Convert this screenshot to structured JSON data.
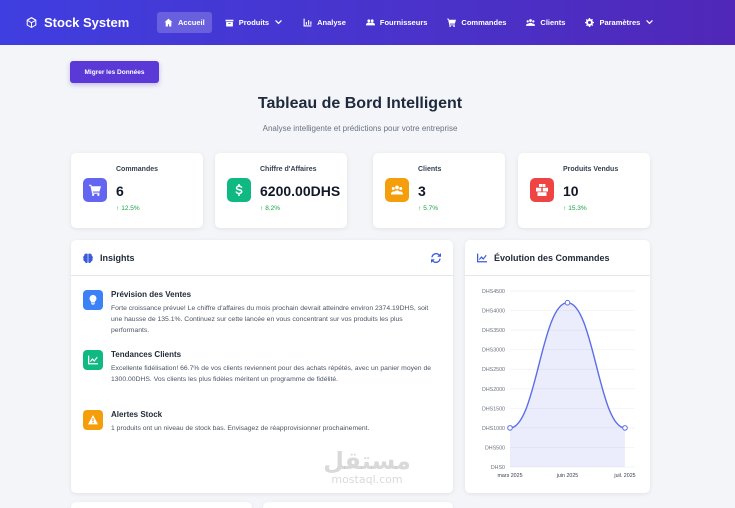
{
  "nav": {
    "brand": "Stock System",
    "items": [
      {
        "label": "Accueil",
        "icon": "home-icon",
        "active": true
      },
      {
        "label": "Produits",
        "icon": "box-icon",
        "dropdown": true
      },
      {
        "label": "Analyse",
        "icon": "bar-chart-icon"
      },
      {
        "label": "Fournisseurs",
        "icon": "people-icon"
      },
      {
        "label": "Commandes",
        "icon": "cart-icon"
      },
      {
        "label": "Clients",
        "icon": "users-icon"
      },
      {
        "label": "Paramètres",
        "icon": "gear-icon",
        "dropdown": true
      }
    ]
  },
  "migrate_button": "Migrer les Données",
  "header": {
    "title": "Tableau de Bord Intelligent",
    "subtitle": "Analyse intelligente et prédictions pour votre entreprise"
  },
  "stats": [
    {
      "label": "Commandes",
      "value": "6",
      "trend": "12.5%",
      "color": "#6366f1",
      "icon": "cart-icon"
    },
    {
      "label": "Chiffre d'Affaires",
      "value": "6200.00DHS",
      "trend": "8.2%",
      "color": "#10b981",
      "icon": "dollar-icon"
    },
    {
      "label": "Clients",
      "value": "3",
      "trend": "5.7%",
      "color": "#f59e0b",
      "icon": "users-icon"
    },
    {
      "label": "Produits Vendus",
      "value": "10",
      "trend": "15.3%",
      "color": "#ef4444",
      "icon": "boxes-icon"
    }
  ],
  "insights_panel": {
    "title": "Insights",
    "items": [
      {
        "title": "Prévision des Ventes",
        "text": "Forte croissance prévue! Le chiffre d'affaires du mois prochain devrait atteindre environ 2374.19DHS, soit une hausse de 135.1%. Continuez sur cette lancée en vous concentrant sur vos produits les plus performants.",
        "color": "#3b82f6",
        "icon": "lightbulb-icon"
      },
      {
        "title": "Tendances Clients",
        "text": "Excellente fidélisation! 66.7% de vos clients reviennent pour des achats répétés, avec un panier moyen de 1300.00DHS. Vos clients les plus fidèles méritent un programme de fidélité.",
        "color": "#10b981",
        "icon": "trend-icon"
      },
      {
        "title": "Alertes Stock",
        "text": "1 produits ont un niveau de stock bas. Envisagez de réapprovisionner prochainement.",
        "color": "#f59e0b",
        "icon": "warning-icon"
      }
    ]
  },
  "chart_panel": {
    "title": "Évolution des Commandes"
  },
  "chart_data": {
    "type": "line",
    "title": "Évolution des Commandes",
    "categories": [
      "mars 2025",
      "juin 2025",
      "juil. 2025"
    ],
    "series": [
      {
        "values": [
          1000,
          4200,
          1000
        ],
        "color": "#5b6ee8"
      }
    ],
    "y_ticks": [
      "DHS0",
      "DHS500",
      "DHS1000",
      "DHS1500",
      "DHS2000",
      "DHS2500",
      "DHS3000",
      "DHS3500",
      "DHS4000",
      "DHS4500"
    ],
    "ylim": [
      0,
      4500
    ],
    "grid": true,
    "fill": true
  },
  "watermark": {
    "arabic": "مستقل",
    "latin": "mostaql.com"
  }
}
